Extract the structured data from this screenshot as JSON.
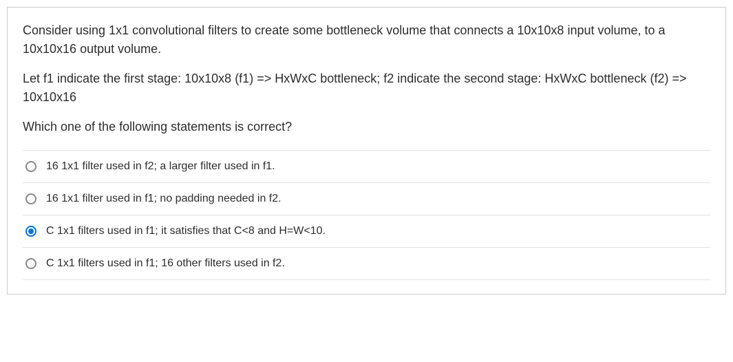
{
  "question": {
    "paragraphs": [
      "Consider using 1x1 convolutional filters to create some bottleneck volume that connects a 10x10x8 input volume, to a 10x10x16 output volume.",
      "Let f1 indicate the first stage: 10x10x8  (f1) => HxWxC bottleneck; f2 indicate the second stage: HxWxC bottleneck (f2) => 10x10x16",
      "Which one of the following statements is correct?"
    ]
  },
  "options": [
    {
      "label": "16 1x1 filter used in f2; a larger filter used in f1.",
      "selected": false
    },
    {
      "label": "16 1x1 filter used in f1; no padding needed in f2.",
      "selected": false
    },
    {
      "label": "C 1x1 filters used in f1; it satisfies that C<8 and H=W<10.",
      "selected": true
    },
    {
      "label": "C 1x1 filters used in f1; 16 other filters used in f2.",
      "selected": false
    }
  ]
}
